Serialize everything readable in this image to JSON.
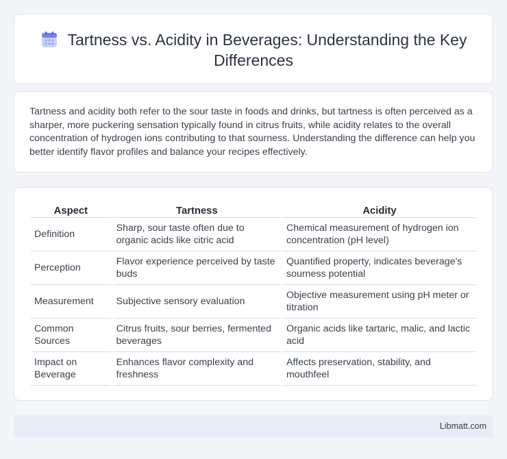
{
  "header": {
    "title": "Tartness vs. Acidity in Beverages: Understanding the Key Differences",
    "icon": "calendar-icon"
  },
  "intro": {
    "text": "Tartness and acidity both refer to the sour taste in foods and drinks, but tartness is often perceived as a sharper, more puckering sensation typically found in citrus fruits, while acidity relates to the overall concentration of hydrogen ions contributing to that sourness. Understanding the difference can help you better identify flavor profiles and balance your recipes effectively."
  },
  "table": {
    "headers": [
      "Aspect",
      "Tartness",
      "Acidity"
    ],
    "rows": [
      [
        "Definition",
        "Sharp, sour taste often due to organic acids like citric acid",
        "Chemical measurement of hydrogen ion concentration (pH level)"
      ],
      [
        "Perception",
        "Flavor experience perceived by taste buds",
        "Quantified property, indicates beverage's sourness potential"
      ],
      [
        "Measurement",
        "Subjective sensory evaluation",
        "Objective measurement using pH meter or titration"
      ],
      [
        "Common Sources",
        "Citrus fruits, sour berries, fermented beverages",
        "Organic acids like tartaric, malic, and lactic acid"
      ],
      [
        "Impact on Beverage",
        "Enhances flavor complexity and freshness",
        "Affects preservation, stability, and mouthfeel"
      ]
    ]
  },
  "footer": {
    "site": "Libmatt.com"
  },
  "colors": {
    "background": "#f3f5f9",
    "card": "#ffffff",
    "footer": "#e8edf6",
    "icon_accent": "#7b8cf0"
  }
}
